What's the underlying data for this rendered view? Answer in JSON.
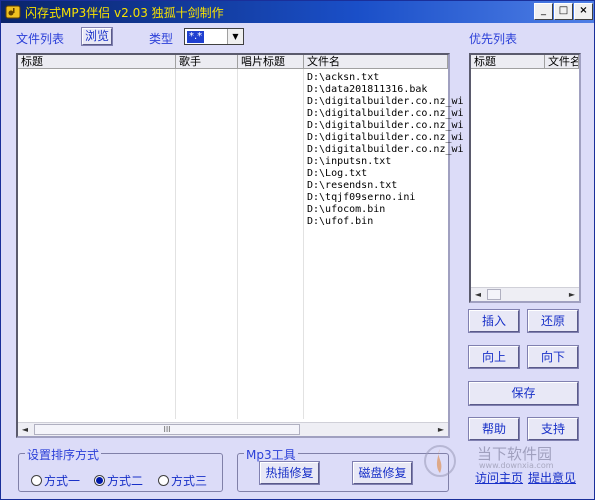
{
  "window": {
    "title": "闪存式MP3伴侣 v2.03 独孤十剑制作",
    "min_label": "_",
    "max_label": "□",
    "close_label": "×"
  },
  "toolbar": {
    "file_list_label": "文件列表",
    "browse_button": "浏览",
    "type_label": "类型",
    "type_value": "*.*"
  },
  "file_table": {
    "columns": [
      "标题",
      "歌手",
      "唱片标题",
      "文件名"
    ],
    "rows": [
      "D:\\acksn.txt",
      "D:\\data201811316.bak",
      "D:\\digitalbuilder.co.nz_wi",
      "D:\\digitalbuilder.co.nz_wi",
      "D:\\digitalbuilder.co.nz_wi",
      "D:\\digitalbuilder.co.nz_wi",
      "D:\\digitalbuilder.co.nz_wi",
      "D:\\inputsn.txt",
      "D:\\Log.txt",
      "D:\\resendsn.txt",
      "D:\\tqjf09serno.ini",
      "D:\\ufocom.bin",
      "D:\\ufof.bin"
    ],
    "scroll_left": "◄",
    "scroll_right": "►",
    "scroll_thumb": "III"
  },
  "priority": {
    "label": "优先列表",
    "columns": [
      "标题",
      "文件名"
    ],
    "scroll_left": "◄",
    "scroll_right": "►"
  },
  "side_buttons": {
    "insert": "插入",
    "restore": "还原",
    "up": "向上",
    "down": "向下",
    "save": "保存",
    "help": "帮助",
    "support": "支持"
  },
  "sort_group": {
    "title": "设置排序方式",
    "options": [
      "方式一",
      "方式二",
      "方式三"
    ],
    "selected": 1
  },
  "mp3_tools": {
    "title": "Mp3工具",
    "hotswap_button": "热插修复",
    "disk_button": "磁盘修复"
  },
  "links": {
    "homepage": "访问主页",
    "feedback": "提出意见"
  },
  "watermark": {
    "text": "当下软件园",
    "sub": "www.downxia.com"
  },
  "colors": {
    "title_text": "#f7e200",
    "label_blue": "#2b3fd8",
    "window_bg": "#dcdcf8",
    "titlebar": "#0a246a"
  }
}
